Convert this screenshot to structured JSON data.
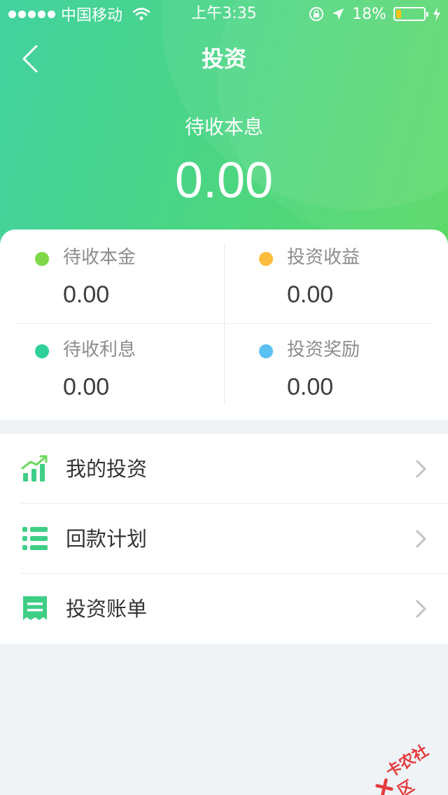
{
  "status_bar": {
    "carrier": "中国移动",
    "time": "上午3:35",
    "battery_percent": "18%",
    "battery_level": 0.18
  },
  "nav": {
    "title": "投资"
  },
  "summary": {
    "label": "待收本息",
    "value": "0.00"
  },
  "stats": [
    {
      "label": "待收本金",
      "value": "0.00",
      "color": "#7ed84a"
    },
    {
      "label": "投资收益",
      "value": "0.00",
      "color": "#fbbd3b"
    },
    {
      "label": "待收利息",
      "value": "0.00",
      "color": "#2ecf9a"
    },
    {
      "label": "投资奖励",
      "value": "0.00",
      "color": "#5bc0f2"
    }
  ],
  "menu": [
    {
      "label": "我的投资",
      "icon": "chart-icon"
    },
    {
      "label": "回款计划",
      "icon": "list-icon"
    },
    {
      "label": "投资账单",
      "icon": "receipt-icon"
    }
  ],
  "watermark": {
    "text": "卡农社区"
  },
  "colors": {
    "header_start": "#43d2a0",
    "header_end": "#5ad966",
    "accent_green": "#2ecf9a"
  }
}
